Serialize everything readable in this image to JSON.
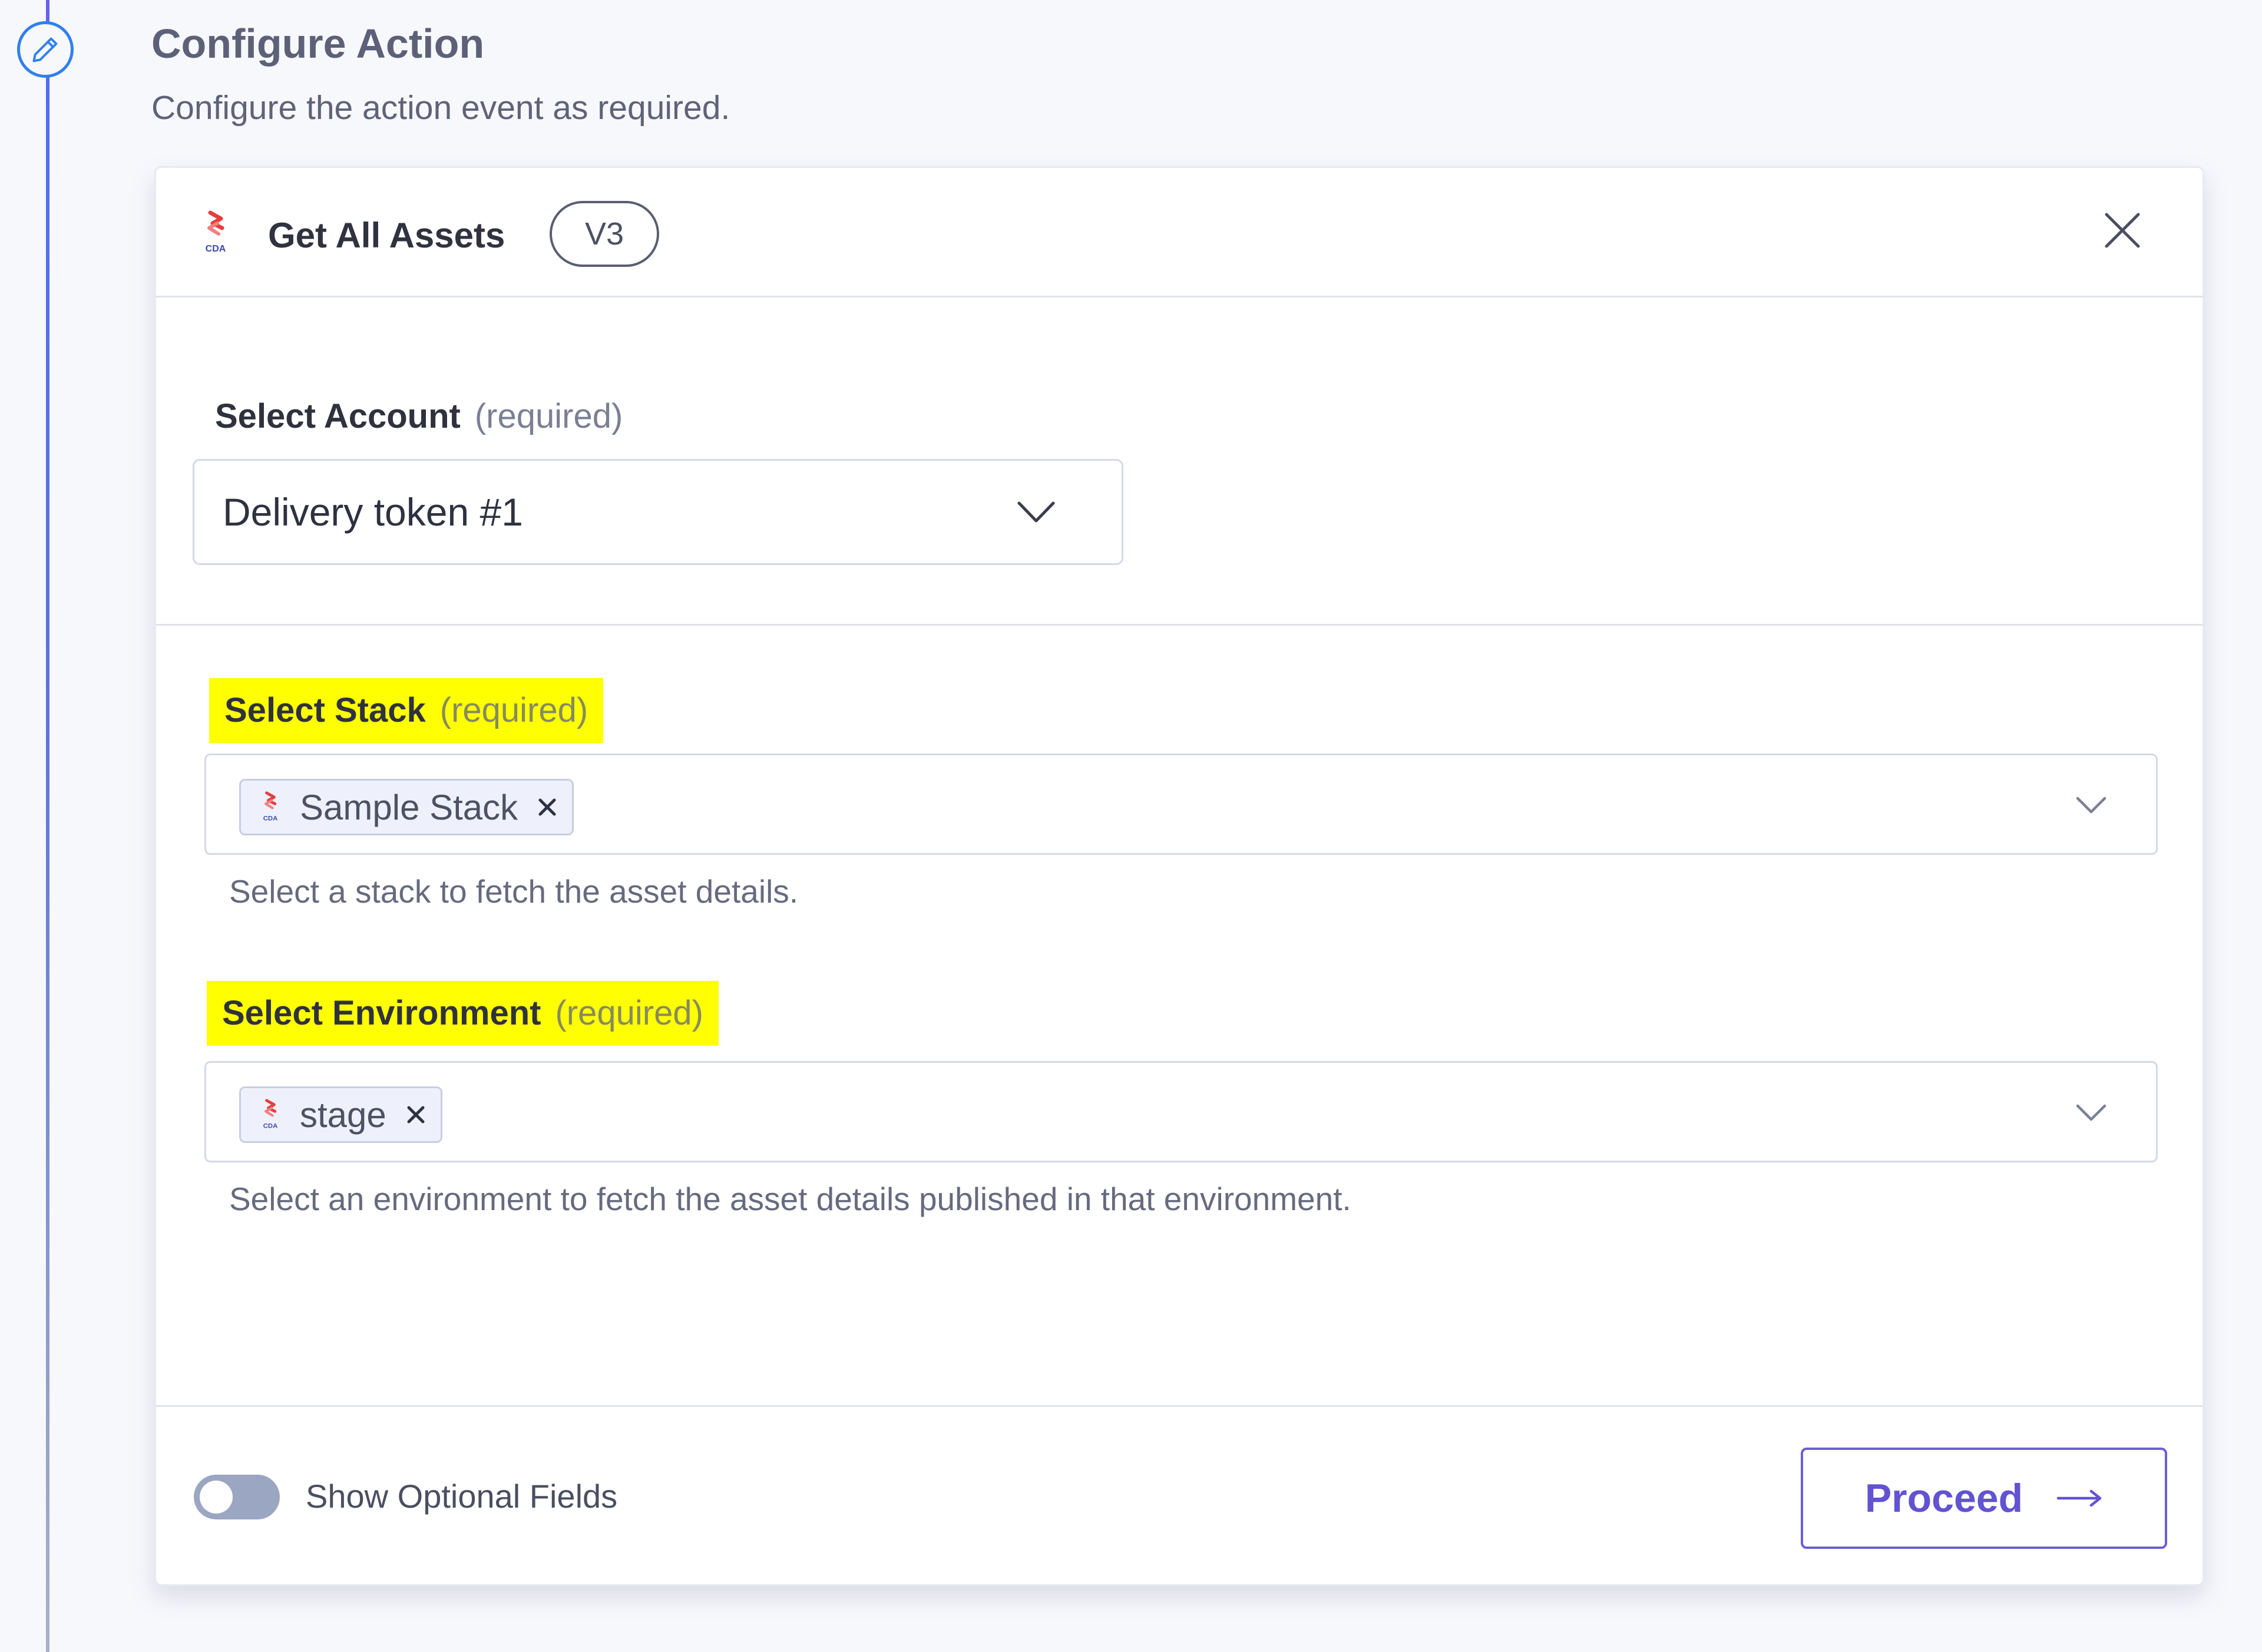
{
  "step": {
    "title": "Configure Action",
    "subtitle": "Configure the action event as required.",
    "icon": "pencil-icon"
  },
  "action": {
    "name": "Get All Assets",
    "version": "V3",
    "logo_icon": "contentstack-cda-logo",
    "close_icon": "close-icon"
  },
  "account": {
    "label": "Select Account",
    "required": "(required)",
    "value": "Delivery token #1"
  },
  "stack": {
    "label": "Select Stack",
    "required": "(required)",
    "chip": "Sample Stack",
    "help": "Select a stack to fetch the asset details."
  },
  "environment": {
    "label": "Select Environment",
    "required": "(required)",
    "chip": "stage",
    "help": "Select an environment to fetch the asset details published in that environment."
  },
  "footer": {
    "toggle_label": "Show Optional Fields",
    "toggle_on": false,
    "proceed_label": "Proceed"
  },
  "colors": {
    "accent": "#6153d2",
    "highlight": "#ffff00",
    "timeline": "#2f80ed"
  }
}
